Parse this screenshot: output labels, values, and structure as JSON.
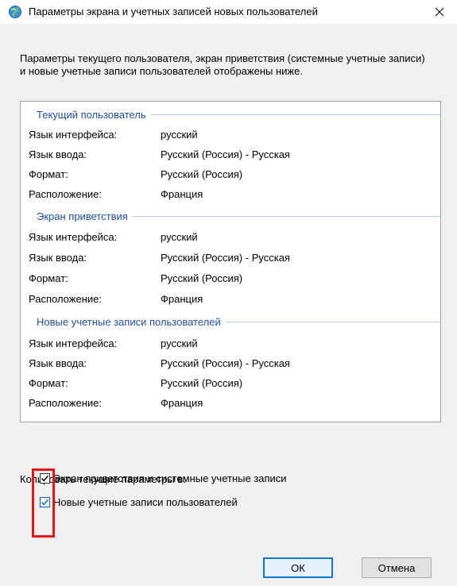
{
  "window": {
    "title": "Параметры экрана и учетных записей новых пользователей"
  },
  "intro": "Параметры текущего пользователя, экран приветствия (системные учетные записи) и новые учетные записи пользователей отображены ниже.",
  "labels": {
    "ui_language": "Язык интерфейса:",
    "input_language": "Язык ввода:",
    "format": "Формат:",
    "location": "Расположение:"
  },
  "sections": [
    {
      "title": "Текущий пользователь",
      "ui_language": "русский",
      "input_language": "Русский (Россия) - Русская",
      "format": "Русский (Россия)",
      "location": "Франция"
    },
    {
      "title": "Экран приветствия",
      "ui_language": "русский",
      "input_language": "Русский (Россия) - Русская",
      "format": "Русский (Россия)",
      "location": "Франция"
    },
    {
      "title": "Новые учетные записи пользователей",
      "ui_language": "русский",
      "input_language": "Русский (Россия) - Русская",
      "format": "Русский (Россия)",
      "location": "Франция"
    }
  ],
  "copy": {
    "label": "Копировать текущие параметры в:",
    "welcome_screen": {
      "label": "Экран приветствия и системные учетные записи",
      "checked": true
    },
    "new_accounts": {
      "label": "Новые учетные записи пользователей",
      "checked": true
    }
  },
  "buttons": {
    "ok": "ОК",
    "cancel": "Отмена"
  },
  "colors": {
    "section_title": "#1f4fa0",
    "highlight": "#e8141a",
    "default_button_border": "#0a78d7"
  }
}
